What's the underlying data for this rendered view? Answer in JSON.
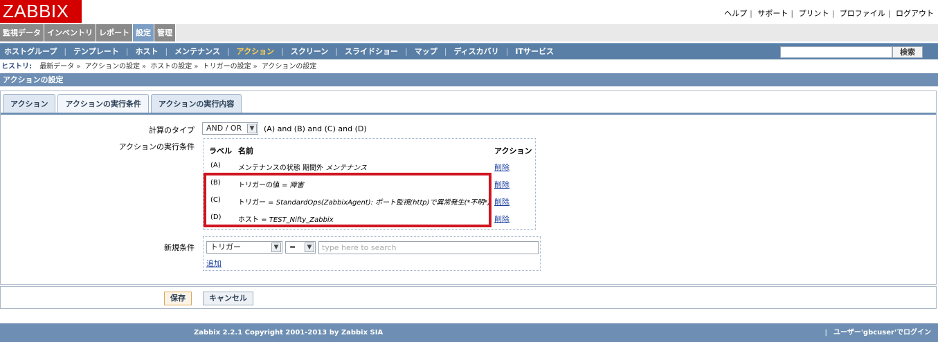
{
  "logo": "ZABBIX",
  "top_links": [
    "ヘルプ",
    "サポート",
    "プリント",
    "プロファイル",
    "ログアウト"
  ],
  "main_menu": [
    "監視データ",
    "インベントリ",
    "レポート",
    "設定",
    "管理"
  ],
  "main_menu_active": "設定",
  "sub_menu": [
    "ホストグループ",
    "テンプレート",
    "ホスト",
    "メンテナンス",
    "アクション",
    "スクリーン",
    "スライドショー",
    "マップ",
    "ディスカバリ",
    "ITサービス"
  ],
  "sub_menu_active": "アクション",
  "search_button": "検索",
  "history": {
    "label": "ヒストリ:",
    "items": [
      "最新データ",
      "アクションの設定",
      "ホストの設定",
      "トリガーの設定",
      "アクションの設定"
    ]
  },
  "section_title": "アクションの設定",
  "tabs": [
    "アクション",
    "アクションの実行条件",
    "アクションの実行内容"
  ],
  "active_tab": "アクションの実行条件",
  "calc_type": {
    "label": "計算のタイプ",
    "value": "AND / OR",
    "formula": "(A) and (B) and (C) and (D)"
  },
  "conditions": {
    "label": "アクションの実行条件",
    "headers": {
      "label": "ラベル",
      "name": "名前",
      "action": "アクション"
    },
    "rows": [
      {
        "tag": "(A)",
        "name": "メンテナンスの状態 期間外 ",
        "value": "メンテナンス",
        "action": "削除"
      },
      {
        "tag": "(B)",
        "name": "トリガーの値 = ",
        "value": "障害",
        "action": "削除"
      },
      {
        "tag": "(C)",
        "name": "トリガー = ",
        "value": "StandardOps(ZabbixAgent): ポート監視(http)で異常発生(*不明*)",
        "action": "削除"
      },
      {
        "tag": "(D)",
        "name": "ホスト = ",
        "value": "TEST_Nifty_Zabbix",
        "action": "削除"
      }
    ]
  },
  "new_condition": {
    "label": "新規条件",
    "type_value": "トリガー",
    "operator_value": "=",
    "search_placeholder": "type here to search",
    "add_label": "追加"
  },
  "buttons": {
    "save": "保存",
    "cancel": "キャンセル"
  },
  "footer": {
    "copyright": "Zabbix 2.2.1 Copyright 2001-2013 by Zabbix SIA",
    "login": "ユーザー'gbcuser'でログイン"
  },
  "colors": {
    "brand": "#d40000",
    "nav": "#5a7fa6",
    "highlight": "#d01420"
  }
}
